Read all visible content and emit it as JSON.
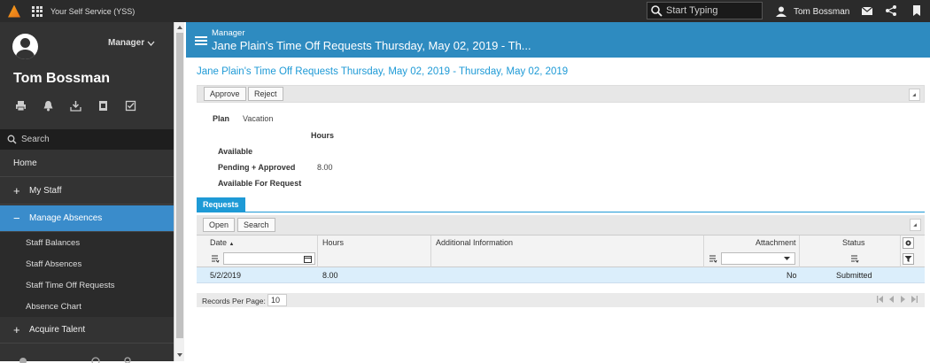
{
  "topbar": {
    "app_title": "Your Self Service (YSS)",
    "search_placeholder": "Start Typing",
    "user_name": "Tom Bossman"
  },
  "sidebar": {
    "role": "Manager",
    "user_name": "Tom Bossman",
    "search_placeholder": "Search",
    "items": [
      {
        "label": "Home"
      },
      {
        "label": "My Staff",
        "sign": "+"
      },
      {
        "label": "Manage Absences",
        "sign": "−"
      },
      {
        "label": "Acquire Talent",
        "sign": "+"
      }
    ],
    "subitems": [
      {
        "label": "Staff Balances"
      },
      {
        "label": "Staff Absences"
      },
      {
        "label": "Staff Time Off Requests"
      },
      {
        "label": "Absence Chart"
      }
    ]
  },
  "header": {
    "subtitle": "Manager",
    "title": "Jane Plain's Time Off Requests Thursday, May 02, 2019 - Th..."
  },
  "main": {
    "heading": "Jane Plain's Time Off Requests Thursday, May 02, 2019 - Thursday, May 02, 2019",
    "toolbar": {
      "approve": "Approve",
      "reject": "Reject"
    },
    "plan": {
      "label": "Plan",
      "value": "Vacation",
      "hours_header": "Hours",
      "rows": [
        {
          "label": "Available",
          "value": ""
        },
        {
          "label": "Pending + Approved",
          "value": "8.00"
        },
        {
          "label": "Available For Request",
          "value": ""
        }
      ]
    },
    "tab": "Requests",
    "grid": {
      "toolbar": {
        "open": "Open",
        "search": "Search"
      },
      "columns": [
        "Date",
        "Hours",
        "Additional Information",
        "Attachment",
        "Status"
      ],
      "sort_marker": "▲",
      "rows": [
        {
          "date": "5/2/2019",
          "hours": "8.00",
          "info": "",
          "attachment": "No",
          "status": "Submitted"
        }
      ],
      "footer": {
        "records_label": "Records Per Page:",
        "records_value": "10"
      }
    }
  }
}
